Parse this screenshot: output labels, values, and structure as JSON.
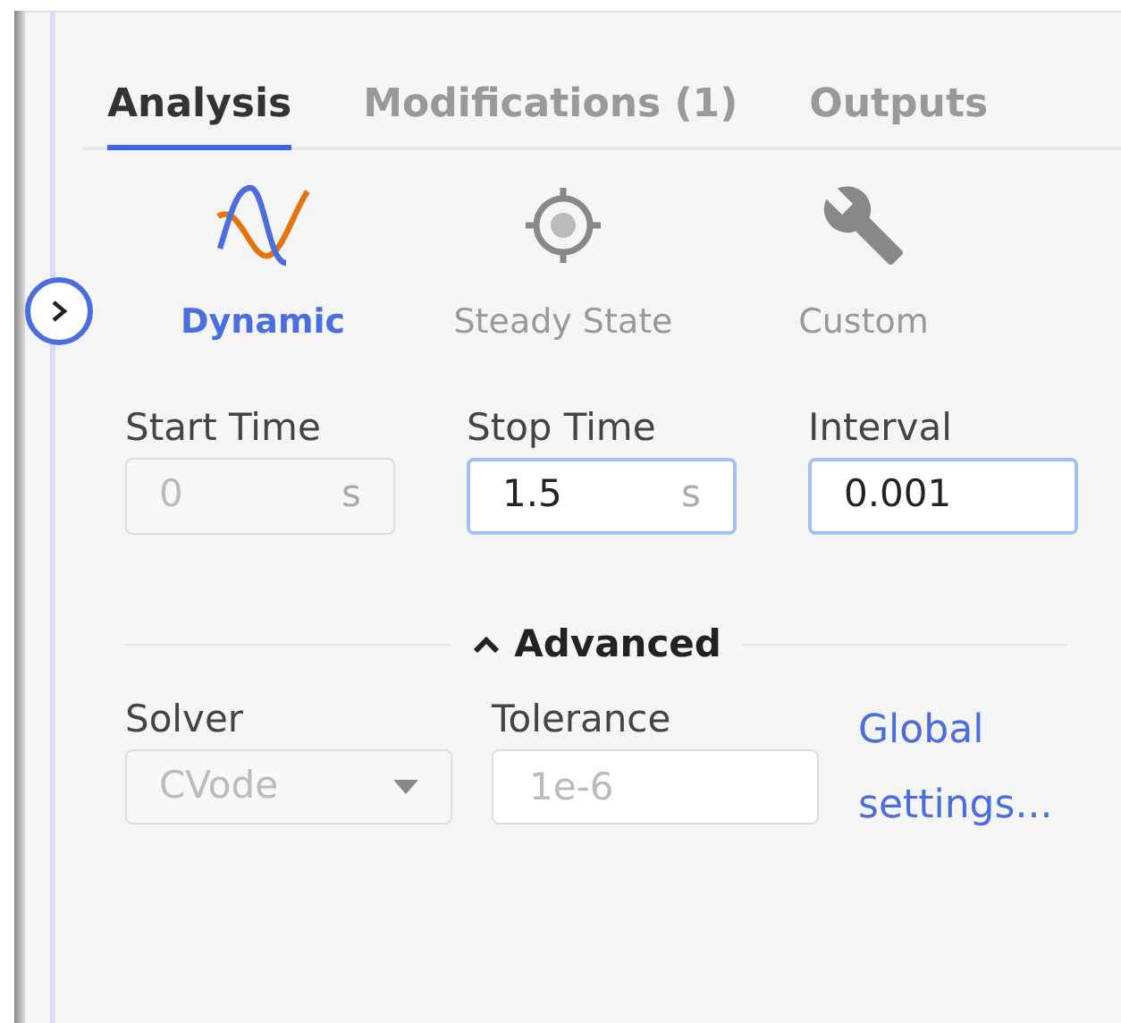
{
  "tabs": [
    {
      "label": "Analysis",
      "selected": true
    },
    {
      "label": "Modifications (1)",
      "selected": false
    },
    {
      "label": "Outputs",
      "selected": false
    }
  ],
  "modes": [
    {
      "kind": "dynamic",
      "label": "Dynamic",
      "selected": true
    },
    {
      "kind": "steady",
      "label": "Steady State",
      "selected": false
    },
    {
      "kind": "custom",
      "label": "Custom",
      "selected": false
    }
  ],
  "time_fields": [
    {
      "label": "Start Time",
      "value": "0",
      "unit": "s",
      "disabled": true
    },
    {
      "label": "Stop Time",
      "value": "1.5",
      "unit": "s",
      "disabled": false
    },
    {
      "label": "Interval",
      "value": "0.001",
      "disabled": false
    }
  ],
  "advanced": {
    "label": "Advanced",
    "expanded": true
  },
  "solver": {
    "label": "Solver",
    "value": "CVode",
    "disabled": true
  },
  "tolerance": {
    "label": "Tolerance",
    "placeholder": "1e-6"
  },
  "global_settings_link": "Global settings..."
}
